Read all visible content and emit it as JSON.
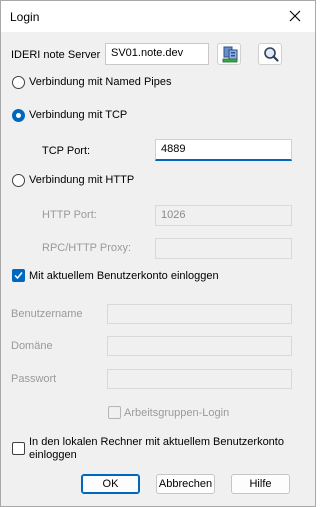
{
  "window": {
    "title": "Login"
  },
  "server": {
    "label": "IDERI note Server",
    "value": "SV01.note.dev"
  },
  "connection": {
    "named_pipes_label": "Verbindung mit Named Pipes",
    "tcp_label": "Verbindung mit TCP",
    "tcp_port_label": "TCP Port:",
    "tcp_port_value": "4889",
    "http_label": "Verbindung mit HTTP",
    "http_port_label": "HTTP Port:",
    "http_port_value": "1026",
    "rpc_proxy_label": "RPC/HTTP Proxy:",
    "rpc_proxy_value": "",
    "selected": "tcp"
  },
  "account": {
    "current_account_label": "Mit aktuellem Benutzerkonto einloggen",
    "current_account_checked": true,
    "username_label": "Benutzername",
    "username_value": "",
    "domain_label": "Domäne",
    "domain_value": "",
    "password_label": "Passwort",
    "password_value": "",
    "workgroup_label": "Arbeitsgruppen-Login",
    "workgroup_checked": false,
    "local_label_line1": "In den lokalen Rechner mit aktuellem Benutzerkonto",
    "local_label_line2": "einloggen",
    "local_checked": false
  },
  "buttons": {
    "ok": "OK",
    "cancel": "Abbrechen",
    "help": "Hilfe"
  },
  "icons": {
    "close": "close-icon",
    "server_browse": "server-browse-icon",
    "search": "search-icon"
  },
  "colors": {
    "accent": "#0067c0",
    "disabled_text": "#9a9a9a",
    "dialog_bg": "#f0f0f0"
  }
}
